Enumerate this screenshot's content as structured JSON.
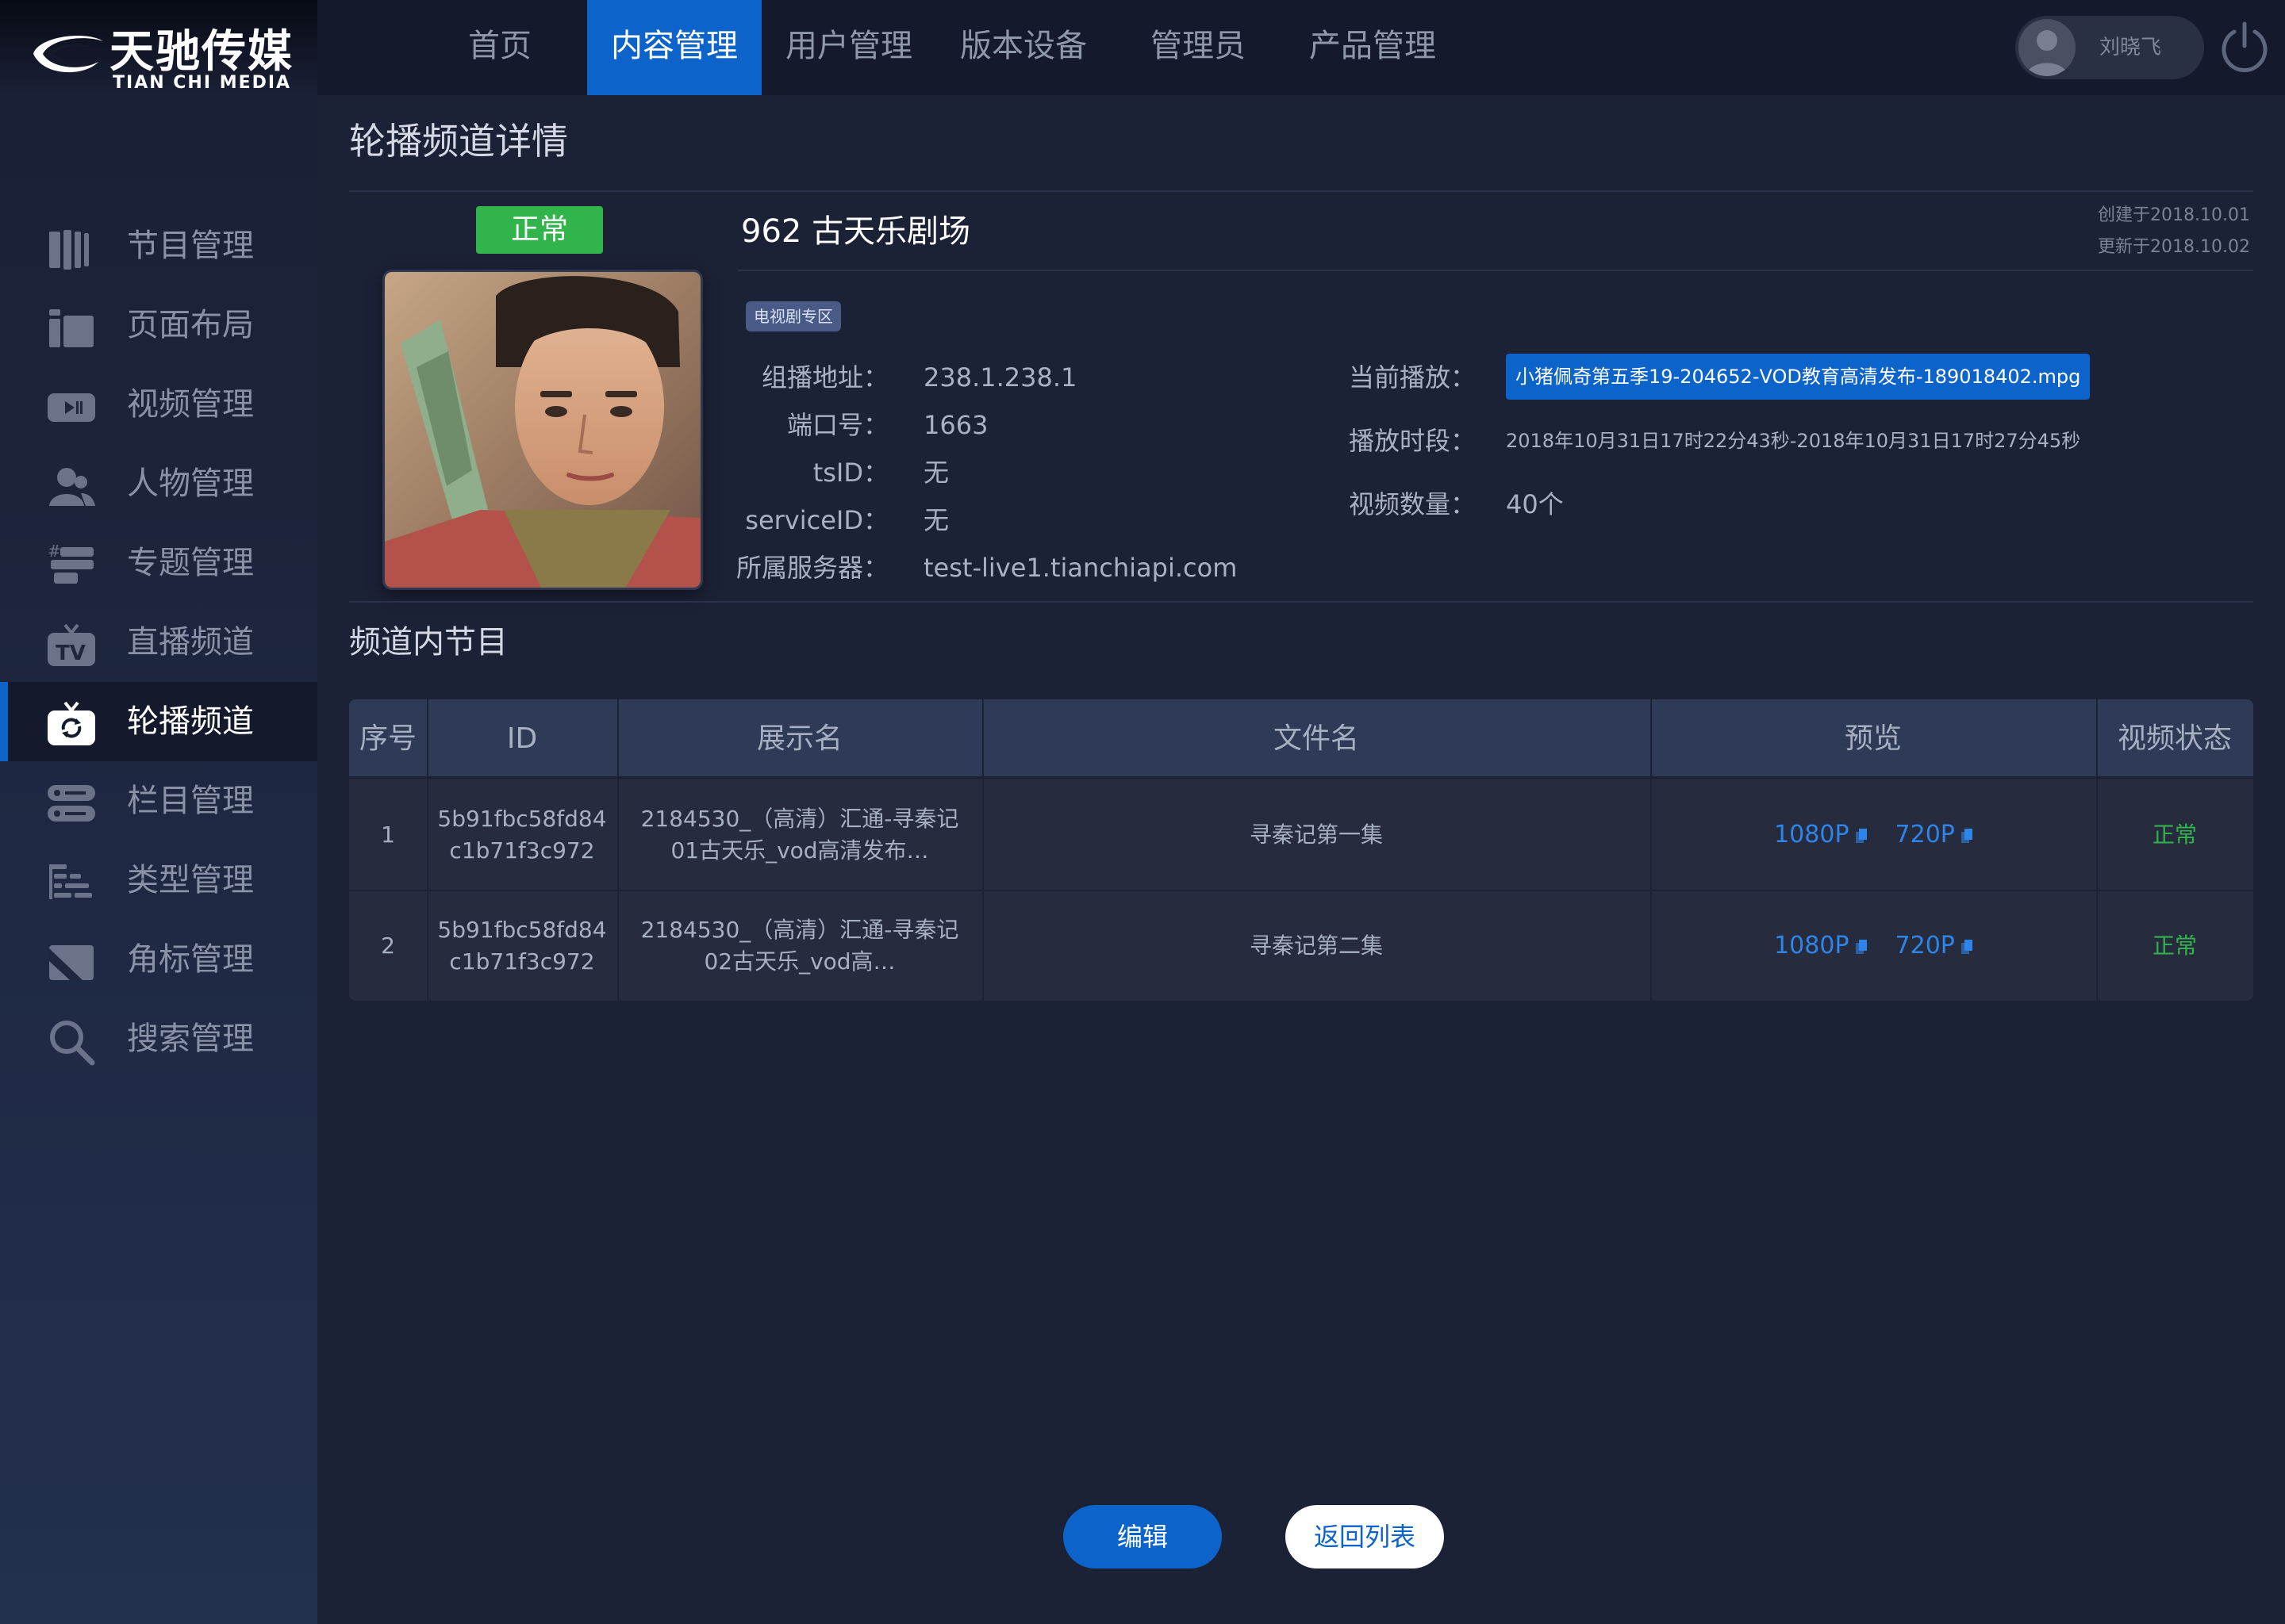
{
  "brand": {
    "name_cn": "天驰传媒",
    "name_en": "TIAN CHI MEDIA"
  },
  "topnav": [
    {
      "label": "首页",
      "active": false
    },
    {
      "label": "内容管理",
      "active": true
    },
    {
      "label": "用户管理",
      "active": false
    },
    {
      "label": "版本设备",
      "active": false
    },
    {
      "label": "管理员",
      "active": false
    },
    {
      "label": "产品管理",
      "active": false
    }
  ],
  "user": {
    "name": "刘晓飞"
  },
  "sidebar": [
    {
      "label": "节目管理",
      "icon": "film-icon"
    },
    {
      "label": "页面布局",
      "icon": "layout-icon"
    },
    {
      "label": "视频管理",
      "icon": "video-icon"
    },
    {
      "label": "人物管理",
      "icon": "people-icon"
    },
    {
      "label": "专题管理",
      "icon": "topic-icon"
    },
    {
      "label": "直播频道",
      "icon": "tv-icon"
    },
    {
      "label": "轮播频道",
      "icon": "carousel-tv-icon",
      "active": true
    },
    {
      "label": "栏目管理",
      "icon": "column-icon"
    },
    {
      "label": "类型管理",
      "icon": "type-icon"
    },
    {
      "label": "角标管理",
      "icon": "badge-corner-icon"
    },
    {
      "label": "搜索管理",
      "icon": "search-icon"
    }
  ],
  "page": {
    "title": "轮播频道详情",
    "section_title": "频道内节目"
  },
  "channel": {
    "status": "正常",
    "name": "962 古天乐剧场",
    "created": "创建于2018.10.01",
    "updated": "更新于2018.10.02",
    "tag": "电视剧专区",
    "fields_left": [
      {
        "label": "组播地址：",
        "value": "238.1.238.1"
      },
      {
        "label": "端口号：",
        "value": "1663"
      },
      {
        "label": "tsID：",
        "value": "无"
      },
      {
        "label": "serviceID：",
        "value": "无"
      },
      {
        "label": "所属服务器：",
        "value": "test-live1.tianchiapi.com"
      }
    ],
    "current_play_label": "当前播放：",
    "current_play_value": "小猪佩奇第五季19-204652-VOD教育高清发布-189018402.mpg",
    "play_time_label": "播放时段：",
    "play_time_value": "2018年10月31日17时22分43秒-2018年10月31日17时27分45秒",
    "video_count_label": "视频数量：",
    "video_count_value": "40个"
  },
  "table": {
    "headers": [
      "序号",
      "ID",
      "展示名",
      "文件名",
      "预览",
      "视频状态"
    ],
    "rows": [
      {
        "index": "1",
        "id_line1": "5b91fbc58fd84",
        "id_line2": "c1b71f3c972",
        "display_line1": "2184530_（高清）汇通-寻秦记",
        "display_line2": "01古天乐_vod高清发布…",
        "filename": "寻秦记第一集",
        "preview_1080": "1080P",
        "preview_720": "720P",
        "status": "正常"
      },
      {
        "index": "2",
        "id_line1": "5b91fbc58fd84",
        "id_line2": "c1b71f3c972",
        "display_line1": "2184530_（高清）汇通-寻秦记",
        "display_line2": "02古天乐_vod高…",
        "filename": "寻秦记第二集",
        "preview_1080": "1080P",
        "preview_720": "720P",
        "status": "正常"
      }
    ]
  },
  "buttons": {
    "edit": "编辑",
    "back": "返回列表"
  },
  "colors": {
    "accent": "#0c63c9",
    "ok": "#31b44b",
    "link": "#2f84e8"
  }
}
